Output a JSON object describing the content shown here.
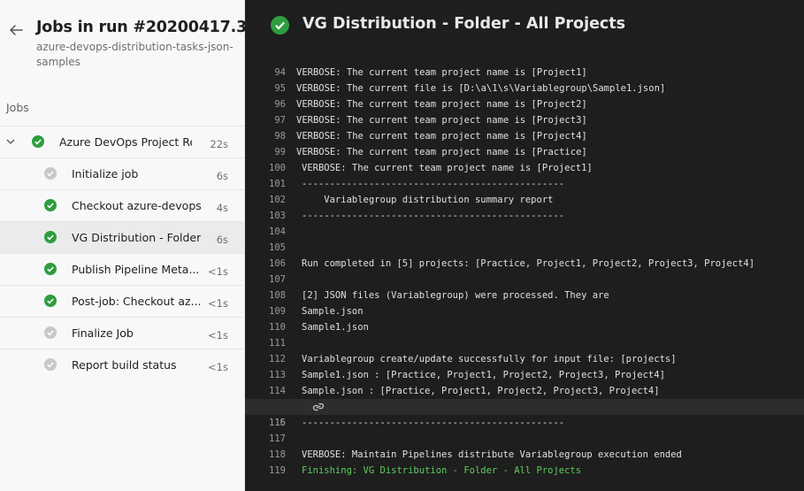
{
  "left_panel": {
    "title": "Jobs in run #20200417.3",
    "subtitle": "azure-devops-distribution-tasks-json-samples",
    "jobs_header": "Jobs",
    "job_group": {
      "name": "Azure DevOps Project Re...",
      "duration": "22s",
      "status": "succeeded"
    },
    "jobs": [
      {
        "name": "Initialize job",
        "duration": "6s",
        "status": "skipped"
      },
      {
        "name": "Checkout azure-devops...",
        "duration": "4s",
        "status": "succeeded"
      },
      {
        "name": "VG Distribution - Folder...",
        "duration": "6s",
        "status": "succeeded",
        "selected": true
      },
      {
        "name": "Publish Pipeline Meta...",
        "duration": "<1s",
        "status": "succeeded"
      },
      {
        "name": "Post-job: Checkout az...",
        "duration": "<1s",
        "status": "succeeded"
      },
      {
        "name": "Finalize Job",
        "duration": "<1s",
        "status": "skipped"
      },
      {
        "name": "Report build status",
        "duration": "<1s",
        "status": "skipped"
      }
    ]
  },
  "right_panel": {
    "title": "VG Distribution - Folder - All Projects",
    "log": [
      {
        "num": "94",
        "text": "VERBOSE: The current team project name is [Project1]"
      },
      {
        "num": "95",
        "text": "VERBOSE: The current file is [D:\\a\\1\\s\\Variablegroup\\Sample1.json]"
      },
      {
        "num": "96",
        "text": "VERBOSE: The current team project name is [Project2]"
      },
      {
        "num": "97",
        "text": "VERBOSE: The current team project name is [Project3]"
      },
      {
        "num": "98",
        "text": "VERBOSE: The current team project name is [Project4]"
      },
      {
        "num": "99",
        "text": "VERBOSE: The current team project name is [Practice]"
      },
      {
        "num": "100",
        "text": "VERBOSE: The current team project name is [Project1]"
      },
      {
        "num": "101",
        "text": "-----------------------------------------------"
      },
      {
        "num": "102",
        "text": "    Variablegroup distribution summary report"
      },
      {
        "num": "103",
        "text": "-----------------------------------------------"
      },
      {
        "num": "104",
        "text": ""
      },
      {
        "num": "105",
        "text": ""
      },
      {
        "num": "106",
        "text": "Run completed in [5] projects: [Practice, Project1, Project2, Project3, Project4]"
      },
      {
        "num": "107",
        "text": ""
      },
      {
        "num": "108",
        "text": "[2] JSON files (Variablegroup) were processed. They are"
      },
      {
        "num": "109",
        "text": "Sample.json"
      },
      {
        "num": "110",
        "text": "Sample1.json"
      },
      {
        "num": "111",
        "text": ""
      },
      {
        "num": "112",
        "text": "Variablegroup create/update successfully for input file: [projects]"
      },
      {
        "num": "113",
        "text": "Sample1.json : [Practice, Project1, Project2, Project3, Project4]"
      },
      {
        "num": "114",
        "text": "Sample.json : [Practice, Project1, Project2, Project3, Project4]"
      },
      {
        "num": "115",
        "text": ""
      },
      {
        "num": "116",
        "text": "-----------------------------------------------"
      },
      {
        "num": "117",
        "text": ""
      },
      {
        "num": "118",
        "text": "VERBOSE: Maintain Pipelines distribute Variablegroup execution ended"
      },
      {
        "num": "119",
        "text": "Finishing: VG Distribution - Folder - All Projects"
      }
    ]
  },
  "colors": {
    "success": "#2e9e3e",
    "skipped": "#a6a6a6",
    "log_success_text": "#5ecb5e"
  },
  "icons": {
    "back": "arrow-left-icon",
    "status_ok": "check-circle-icon",
    "status_skipped": "check-circle-gray-icon",
    "collapse": "chevron-down-icon",
    "link": "link-icon"
  }
}
